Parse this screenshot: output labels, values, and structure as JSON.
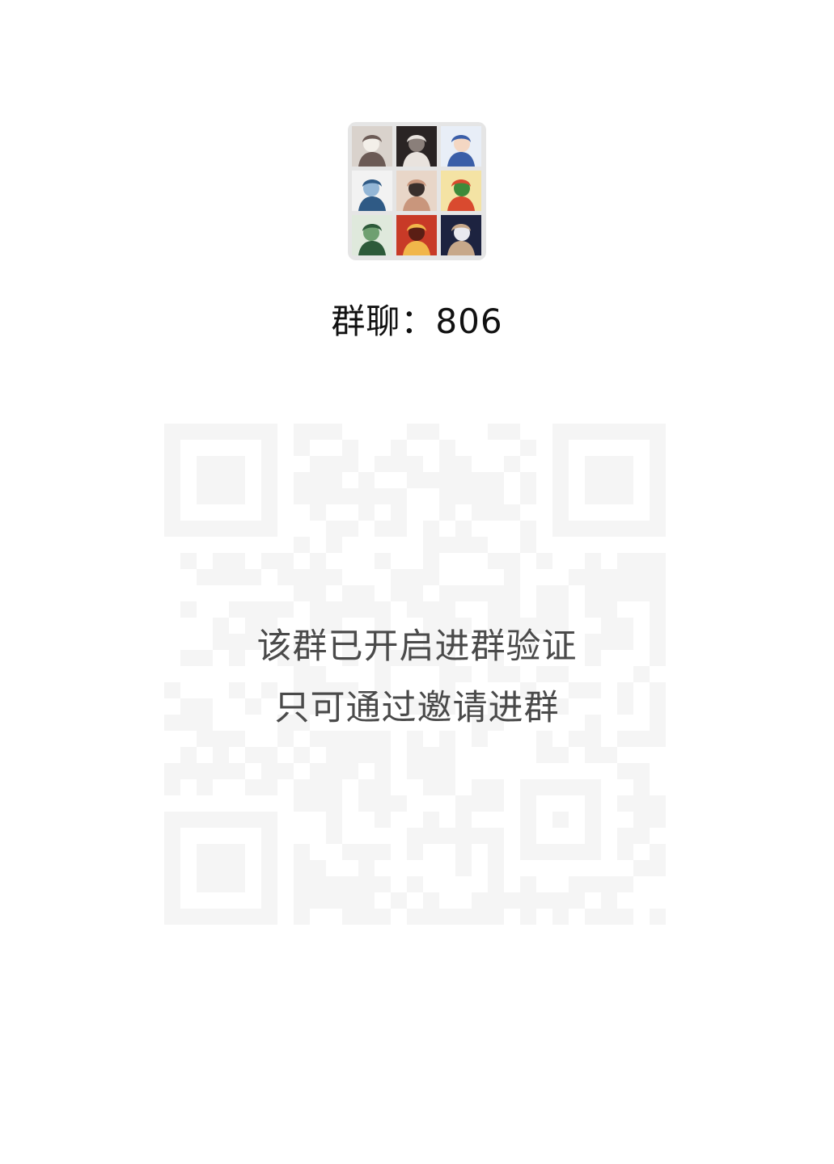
{
  "group": {
    "title": "群聊：806",
    "avatars": [
      {
        "name": "avatar-1",
        "colors": [
          "#d9d2cc",
          "#6b5a55",
          "#f3efe9"
        ]
      },
      {
        "name": "avatar-2",
        "colors": [
          "#2a2424",
          "#e9e3de",
          "#8a7f7a"
        ]
      },
      {
        "name": "avatar-3",
        "colors": [
          "#e8eef7",
          "#3a5ea8",
          "#f4d7c3"
        ]
      },
      {
        "name": "avatar-4",
        "colors": [
          "#f2f2f2",
          "#2f5a85",
          "#93b6d6"
        ]
      },
      {
        "name": "avatar-5",
        "colors": [
          "#e8d6c8",
          "#c9967c",
          "#3a2f2c"
        ]
      },
      {
        "name": "avatar-6",
        "colors": [
          "#f4e3a4",
          "#d94a2f",
          "#3e8a3a"
        ]
      },
      {
        "name": "avatar-7",
        "colors": [
          "#dfe9dc",
          "#2d5a3a",
          "#6fa071"
        ]
      },
      {
        "name": "avatar-8",
        "colors": [
          "#c83a27",
          "#f1b64a",
          "#5a1e14"
        ]
      },
      {
        "name": "avatar-9",
        "colors": [
          "#1d2340",
          "#c7a88a",
          "#e9e9ef"
        ]
      }
    ]
  },
  "qr": {
    "color": "#f5f5f5"
  },
  "notice": {
    "line1": "该群已开启进群验证",
    "line2": "只可通过邀请进群"
  }
}
